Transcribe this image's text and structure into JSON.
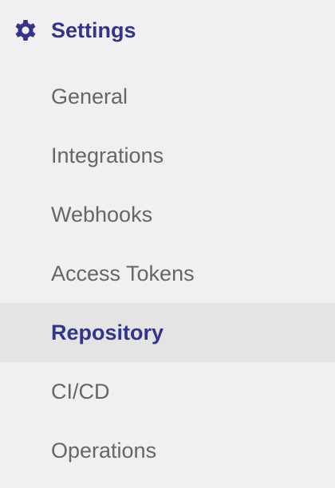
{
  "section": {
    "title": "Settings",
    "icon": "gear-icon",
    "accent_color": "#34348c"
  },
  "nav": {
    "items": [
      {
        "label": "General"
      },
      {
        "label": "Integrations"
      },
      {
        "label": "Webhooks"
      },
      {
        "label": "Access Tokens"
      },
      {
        "label": "Repository",
        "active": true
      },
      {
        "label": "CI/CD"
      },
      {
        "label": "Operations"
      }
    ]
  },
  "colors": {
    "background": "#f0f0f0",
    "active_background": "#e4e4e4",
    "text": "#666666",
    "accent": "#34348c"
  }
}
